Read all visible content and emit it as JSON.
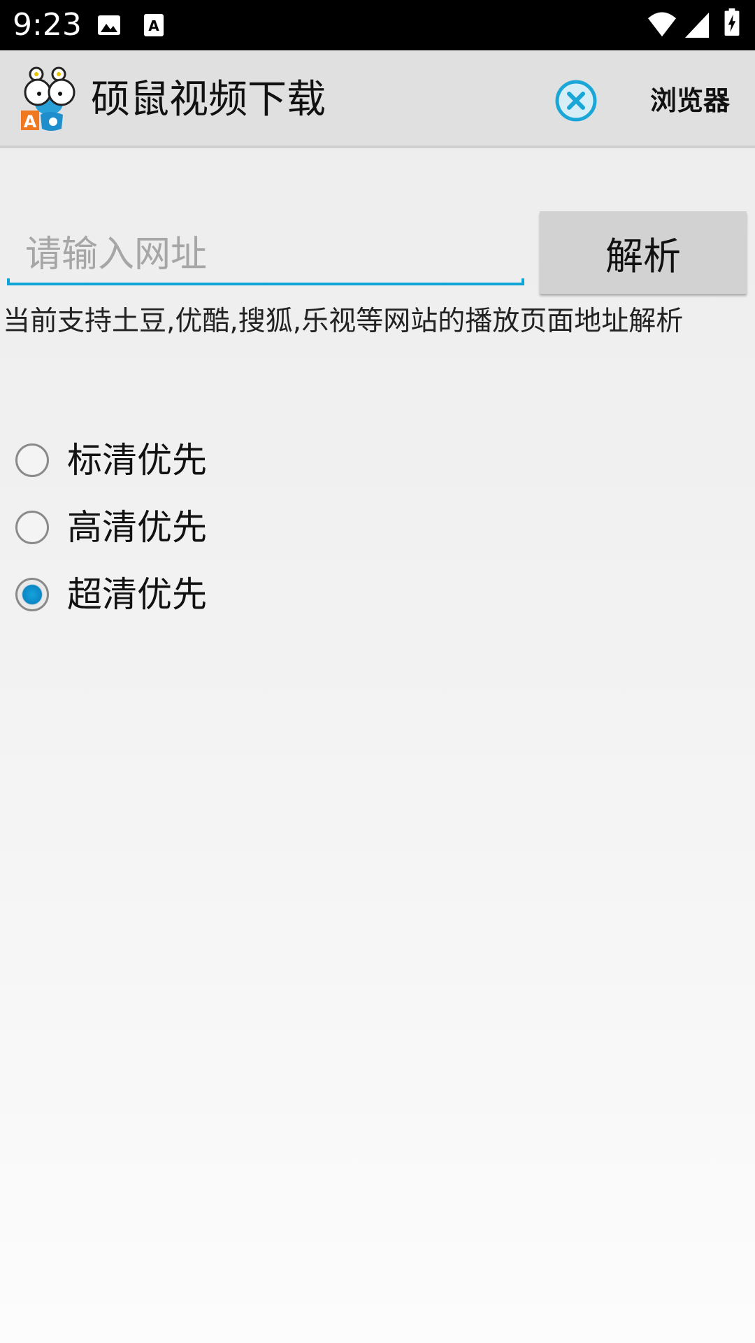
{
  "status_bar": {
    "time": "9:23",
    "icons": [
      "image-icon",
      "text-a-icon",
      "wifi-icon",
      "cellular-icon",
      "battery-charging-icon"
    ]
  },
  "app_bar": {
    "title": "硕鼠视频下载",
    "logo_icon": "mouse-mascot-logo",
    "clear_icon": "close-circle-icon",
    "browser_label": "浏览器"
  },
  "url_form": {
    "placeholder": "请输入网址",
    "value": "",
    "parse_label": "解析",
    "hint": "当前支持土豆,优酷,搜狐,乐视等网站的播放页面地址解析"
  },
  "quality_options": [
    {
      "label": "标清优先",
      "checked": false
    },
    {
      "label": "高清优先",
      "checked": false
    },
    {
      "label": "超清优先",
      "checked": true
    }
  ],
  "colors": {
    "accent": "#0fa4d6",
    "status_bar": "#000000",
    "app_bar": "#e0e0e0",
    "button": "#d2d2d2"
  }
}
